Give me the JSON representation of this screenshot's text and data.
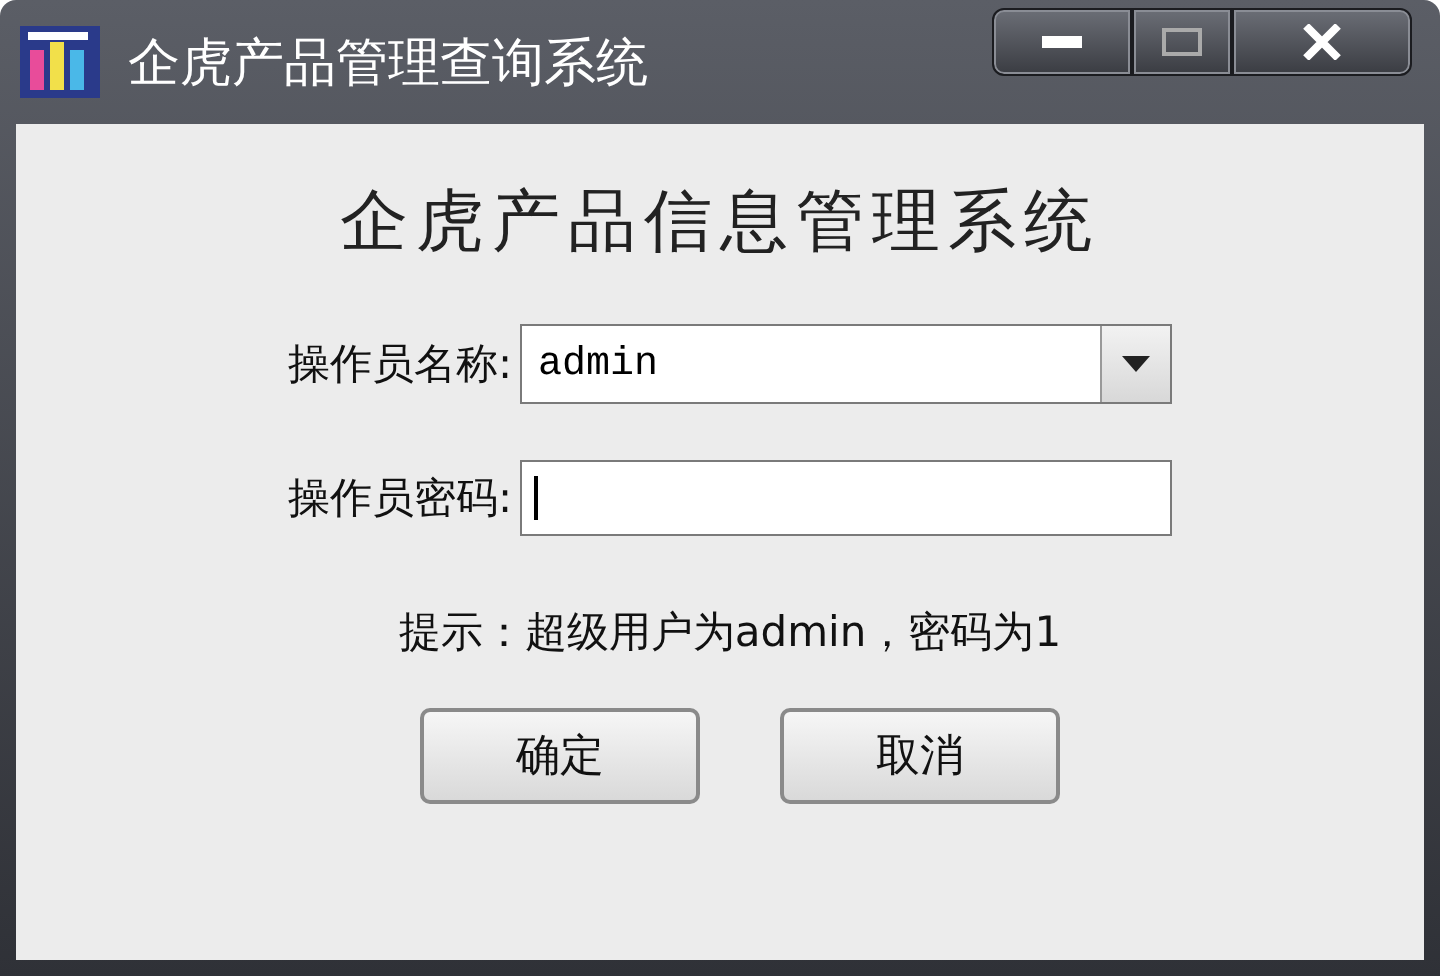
{
  "window": {
    "title": "企虎产品管理查询系统"
  },
  "heading": "企虎产品信息管理系统",
  "fields": [
    {
      "kind": "combo",
      "label": "操作员名称:",
      "value": "admin"
    },
    {
      "kind": "password",
      "label": "操作员密码:"
    }
  ],
  "hint": "提示：超级用户为admin，密码为1",
  "buttons": [
    "确定",
    "取消"
  ]
}
